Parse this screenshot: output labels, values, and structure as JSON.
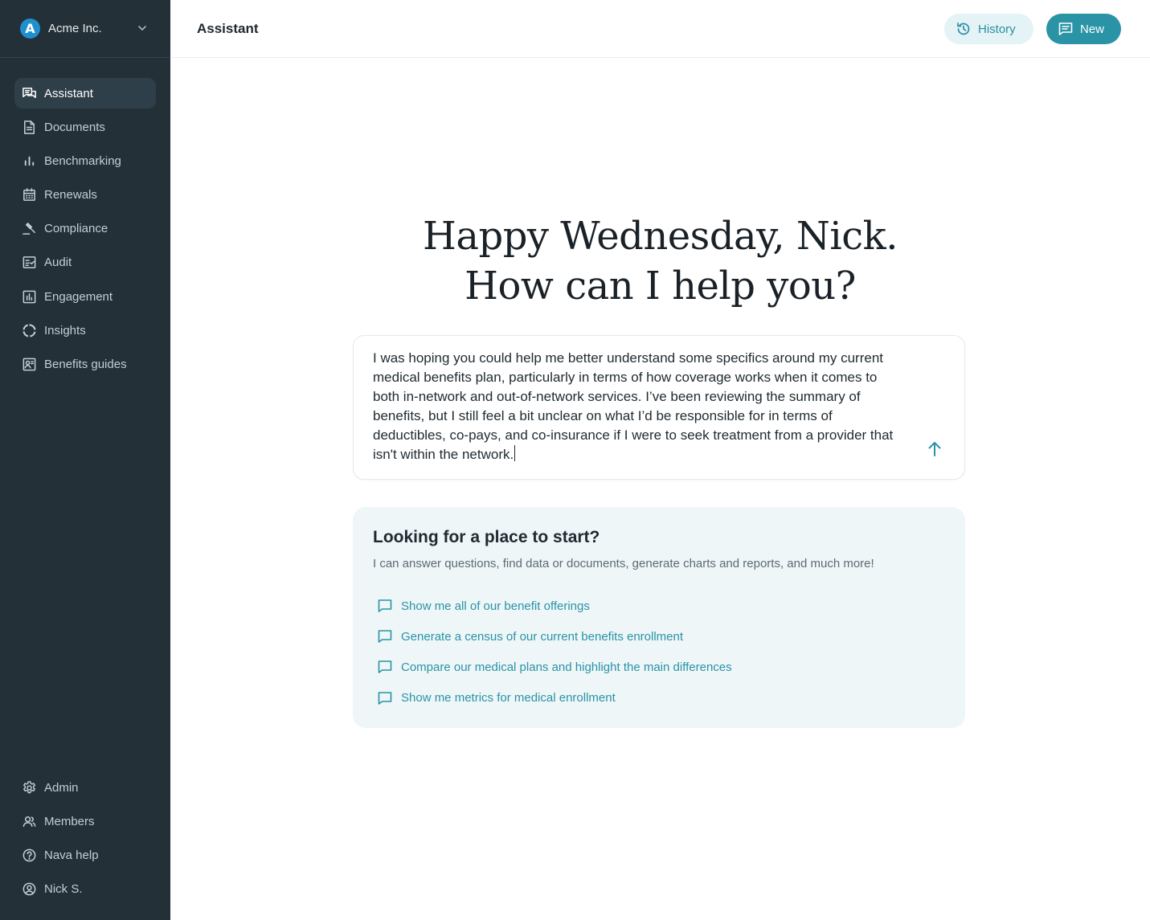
{
  "org": {
    "logo_letter": "A",
    "name": "Acme Inc.",
    "brand_color": "#1f8fd0"
  },
  "sidebar": {
    "items": [
      {
        "label": "Assistant",
        "icon": "chat-bubbles-icon",
        "active": true
      },
      {
        "label": "Documents",
        "icon": "document-icon"
      },
      {
        "label": "Benchmarking",
        "icon": "bar-chart-icon"
      },
      {
        "label": "Renewals",
        "icon": "calendar-icon"
      },
      {
        "label": "Compliance",
        "icon": "gavel-icon"
      },
      {
        "label": "Audit",
        "icon": "checklist-icon"
      },
      {
        "label": "Engagement",
        "icon": "chart-box-icon"
      },
      {
        "label": "Insights",
        "icon": "donut-icon"
      },
      {
        "label": "Benefits guides",
        "icon": "presentation-icon"
      }
    ],
    "bottom": [
      {
        "label": "Admin",
        "icon": "gear-icon"
      },
      {
        "label": "Members",
        "icon": "users-icon"
      },
      {
        "label": "Nava help",
        "icon": "help-circle-icon"
      },
      {
        "label": "Nick S.",
        "icon": "user-circle-icon"
      }
    ]
  },
  "header": {
    "title": "Assistant",
    "history_label": "History",
    "new_label": "New"
  },
  "greeting": {
    "line1": "Happy Wednesday, Nick.",
    "line2": "How can I help you?"
  },
  "composer": {
    "value": "I was hoping you could help me better understand some specifics around my current medical benefits plan, particularly in terms of how coverage works when it comes to both in-network and out-of-network services. I’ve been reviewing the summary of benefits, but I still feel a bit unclear on what I’d be responsible for in terms of deductibles, co-pays, and co-insurance if I were to seek treatment from a provider that isn't within the network."
  },
  "starter": {
    "title": "Looking for a place to start?",
    "subtitle": "I can answer questions, find data or documents, generate charts and reports, and much more!",
    "suggestions": [
      "Show me all of our benefit offerings",
      "Generate a census of our current benefits enrollment",
      "Compare our medical plans and highlight the main differences",
      "Show me metrics for medical enrollment"
    ]
  },
  "colors": {
    "sidebar_bg": "#233038",
    "accent": "#2a93a6",
    "accent_soft": "#e4f3f5",
    "starter_bg": "#eef6f8"
  }
}
